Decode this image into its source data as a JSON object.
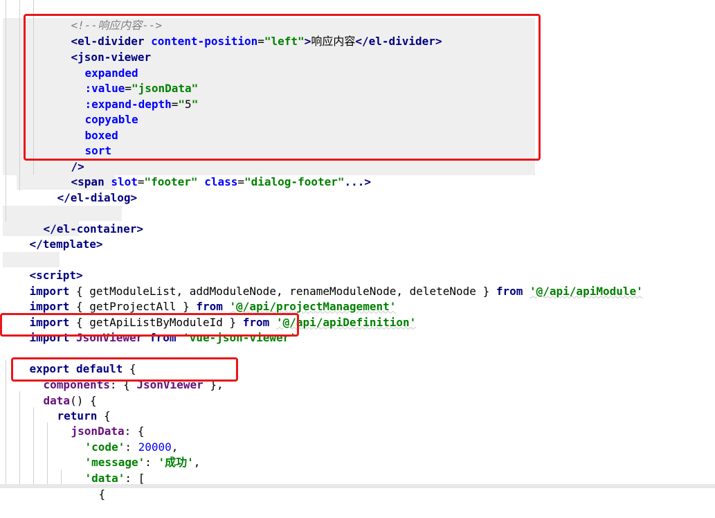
{
  "code": {
    "l01": {
      "cmt": "<!--响应内容-->"
    },
    "l02": {
      "t1": "<el-divider ",
      "a1": "content-position",
      "eq": "=",
      "s1": "\"left\"",
      "t2": ">",
      "txt": "响应内容",
      "t3": "</el-divider>"
    },
    "l03": {
      "t1": "<json-viewer"
    },
    "l04": {
      "a1": "expanded"
    },
    "l05": {
      "a1": ":value",
      "eq": "=",
      "s1": "\"jsonData\""
    },
    "l06": {
      "a1": ":expand-depth",
      "eq": "=",
      "q1": "\"",
      "n1": "5",
      "q2": "\""
    },
    "l07": {
      "a1": "copyable"
    },
    "l08": {
      "a1": "boxed"
    },
    "l09": {
      "a1": "sort"
    },
    "l10": {
      "t1": "/>"
    },
    "l11": {
      "t1": "<span ",
      "a1": "slot",
      "eq1": "=",
      "s1": "\"footer\"",
      "a2": " class",
      "eq2": "=",
      "s2": "\"dialog-footer\"",
      "t2": "...>"
    },
    "l12": {
      "t1": "</el-dialog>"
    },
    "l13": {
      "t1": "</el-container>"
    },
    "l14": {
      "t1": "</template>"
    },
    "l15": {
      "t1": "<script>"
    },
    "l16": {
      "k1": "import",
      "p1": " { getModuleList, addModuleNode, renameModuleNode, deleteNode } ",
      "k2": "from",
      "sp": " ",
      "s1": "'@/api/apiModule'"
    },
    "l17": {
      "k1": "import",
      "p1": " { getProjectAll } ",
      "k2": "from",
      "sp": " ",
      "s1": "'@/api/projectManagement'"
    },
    "l18": {
      "k1": "import",
      "p1": " { getApiListByModuleId } ",
      "k2": "from",
      "sp": " ",
      "s1": "'@/api/apiDefinition'"
    },
    "l19": {
      "k1": "import",
      "p1": " ",
      "pr1": "JsonViewer",
      "sp": " ",
      "k2": "from",
      "sp2": " ",
      "s1": "'vue-json-viewer'"
    },
    "l20": {
      "k1": "export default",
      "p1": " {"
    },
    "l21": {
      "pr1": "components",
      "p1": ": { ",
      "pr2": "JsonViewer",
      "p2": " },"
    },
    "l22": {
      "pr1": "data",
      "p1": "() {"
    },
    "l23": {
      "k1": "return",
      "p1": " {"
    },
    "l24": {
      "pr1": "jsonData",
      "p1": ": {"
    },
    "l25": {
      "s1": "'code'",
      "p1": ": ",
      "n1": "20000",
      "p2": ","
    },
    "l26": {
      "s1": "'message'",
      "p1": ": ",
      "s2": "'成功'",
      "p2": ","
    },
    "l27": {
      "s1": "'data'",
      "p1": ": ["
    },
    "l28": {
      "p1": "{"
    }
  }
}
